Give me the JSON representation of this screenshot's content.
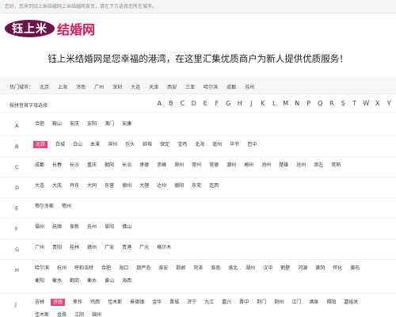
{
  "topbar": {
    "notice": "您好，您来到钰上米结婚网上米结婚网首页，请在下方选择您所在城市。"
  },
  "logo": {
    "brand": "钰上米",
    "suffix": "结婚网"
  },
  "slogan": "钰上米结婚网是您幸福的港湾，在这里汇集优质商户为新人提供优质服务！",
  "hot_cities": {
    "label": "热门城市：",
    "items": [
      "北京",
      "上海",
      "济南",
      "广州",
      "深圳",
      "大连",
      "天津",
      "西安",
      "三亚",
      "哈尔滨",
      "成都",
      "苏州"
    ]
  },
  "alpha": {
    "label": "按拼音首字母选择",
    "letters": [
      "A",
      "B",
      "C",
      "D",
      "E",
      "F",
      "G",
      "H",
      "J",
      "K",
      "L",
      "M",
      "N",
      "P",
      "Q",
      "R",
      "S",
      "T",
      "W",
      "X",
      "Y",
      "Z"
    ]
  },
  "groups": [
    {
      "letter": "A",
      "cities": [
        "合肥",
        "鞍山",
        "安庆",
        "安阳",
        "澳门",
        "安康"
      ]
    },
    {
      "letter": "B",
      "cities": [
        "北京",
        "白城",
        "白山",
        "本溪",
        "滨州",
        "包头",
        "蚌埠",
        "保定",
        "宝鸡",
        "北海",
        "亳州",
        "毕节",
        "巴中"
      ],
      "active": "北京"
    },
    {
      "letter": "C",
      "cities": [
        "成都",
        "长春",
        "长沙",
        "重庆",
        "朝阳",
        "长治",
        "承德",
        "赤峰",
        "滁州",
        "常州",
        "常德",
        "潮州",
        "郴州",
        "池州",
        "楚雄",
        "沧州",
        "崇左",
        "常熟"
      ]
    },
    {
      "letter": "D",
      "cities": [
        "大连",
        "大庆",
        "丹东",
        "大同",
        "东营",
        "德州",
        "大理",
        "达州",
        "德阳",
        "东莞",
        "定西"
      ]
    },
    {
      "letter": "E",
      "cities": [
        "鄂尔多斯",
        "鄂州"
      ]
    },
    {
      "letter": "F",
      "cities": [
        "福州",
        "抚顺",
        "阜新",
        "抚州",
        "阜阳",
        "佛山"
      ]
    },
    {
      "letter": "G",
      "cities": [
        "广州",
        "贵阳",
        "桂林",
        "赣州",
        "广安",
        "贵港",
        "广元",
        "格尔木"
      ]
    },
    {
      "letter": "H",
      "cities": [
        "哈尔滨",
        "杭州",
        "呼和浩特",
        "合肥",
        "海口",
        "葫芦岛",
        "淮安",
        "邯郸",
        "菏泽",
        "淮南",
        "淮北",
        "湖州",
        "汉中",
        "鹤壁",
        "河源",
        "黄冈",
        "怀化",
        "黄石",
        "衡阳",
        "衡水",
        "鹤岗",
        "衡水",
        "黄山",
        "海西"
      ]
    },
    {
      "letter": "J",
      "cities": [
        "吉林",
        "济南",
        "焦作",
        "鸡西",
        "佳木斯",
        "景德镇",
        "金华",
        "晋城",
        "济宁",
        "九江",
        "嘉兴",
        "晋中",
        "荆门",
        "荆州",
        "江门",
        "酒泉",
        "揭阳",
        "嘉峪关",
        "佳木斯",
        "金昌",
        "江阴",
        "锦州"
      ],
      "active": "济南"
    }
  ],
  "colors": {
    "logo_bg": "#6b1447",
    "accent": "#e0195b",
    "active_city_bg": "#e8457c"
  }
}
